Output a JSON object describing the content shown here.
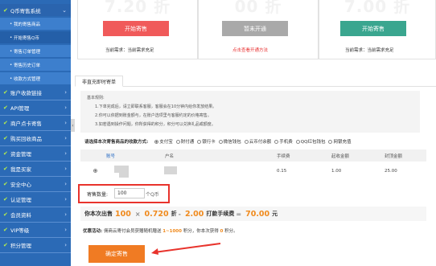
{
  "sidebar": {
    "groups": [
      {
        "label": "Q币寄售系统",
        "open": true
      },
      {
        "label": "账户收款链接"
      },
      {
        "label": "API管理"
      },
      {
        "label": "商户点卡寄售"
      },
      {
        "label": "购买回收商品"
      },
      {
        "label": "资金管理"
      },
      {
        "label": "我是买家"
      },
      {
        "label": "安全中心"
      },
      {
        "label": "认证管理"
      },
      {
        "label": "会员资料"
      },
      {
        "label": "VIP等级"
      },
      {
        "label": "积分管理"
      }
    ],
    "sub_items": [
      {
        "label": "我的寄售商品"
      },
      {
        "label": "开始寄售Q币",
        "active": true
      },
      {
        "label": "寄售订单管理"
      },
      {
        "label": "寄售历史订单"
      },
      {
        "label": "收款方式管理"
      }
    ],
    "toggle": "‹"
  },
  "cards": [
    {
      "price": "7.20 折",
      "button": "开始寄售",
      "button_color": "#f05a5a",
      "note": "当前需求：当前需求充足",
      "note_color": "#333333"
    },
    {
      "price": "00 折",
      "button": "暂未开通",
      "button_color": "#a9a9a9",
      "note": "点击查看开通方法",
      "note_color": "#e83030"
    },
    {
      "price": "7.00 折",
      "button": "开始寄售",
      "button_color": "#3aa68f",
      "note": "当前需求：当前需求充足",
      "note_color": "#333333"
    }
  ],
  "tab": {
    "label": "非直充即时寄单"
  },
  "instructions": {
    "title": "基本规则:",
    "lines": [
      "1.下单完成后，请立即联系客服，客服会在10分钟内给你发放结果。",
      "2.你可以依据到账金额与，在账户选项里与客服约定的价格寄售。",
      "3.如若遇到操作问题，你所获得的积分，积分可以兑换礼品或额度。"
    ]
  },
  "payment_mode": {
    "label": "请选择本次寄售商品的收款方式:",
    "options": [
      {
        "label": "支付宝",
        "selected": true
      },
      {
        "label": "财付通"
      },
      {
        "label": "银行卡"
      },
      {
        "label": "微信钱包"
      },
      {
        "label": "云币付余额"
      },
      {
        "label": "手机费"
      },
      {
        "label": "QQ红包钱包"
      },
      {
        "label": "网银充值"
      }
    ]
  },
  "table": {
    "headers": [
      "账号",
      "户名",
      "手续费",
      "起收金额",
      "封顶金额"
    ],
    "rows": [
      {
        "fee": "0.15",
        "min": "1.00",
        "max": "25.00"
      }
    ]
  },
  "quantity": {
    "label": "寄售数量:",
    "value": "100",
    "unit": "个Q币"
  },
  "calc": {
    "prefix": "你本次出售",
    "qty": "100",
    "times": "×",
    "rate": "0.720",
    "rate_unit": "折",
    "minus": "-",
    "fee": "2.00",
    "fee_label": "打款手续费",
    "equals": "=",
    "total": "70.00",
    "total_unit": "元"
  },
  "promo": {
    "label": "优惠活动:",
    "text1": "佣商云寄付会员获赠随机赠送",
    "range": "1~1000",
    "text2": "积分，你本次获得",
    "points": "0",
    "text3": "积分。"
  },
  "confirm_button": "确定寄售",
  "colors": {
    "sidebar": "#2b6ab6",
    "accent": "#f08a1d",
    "highlight": "#e8332c"
  }
}
